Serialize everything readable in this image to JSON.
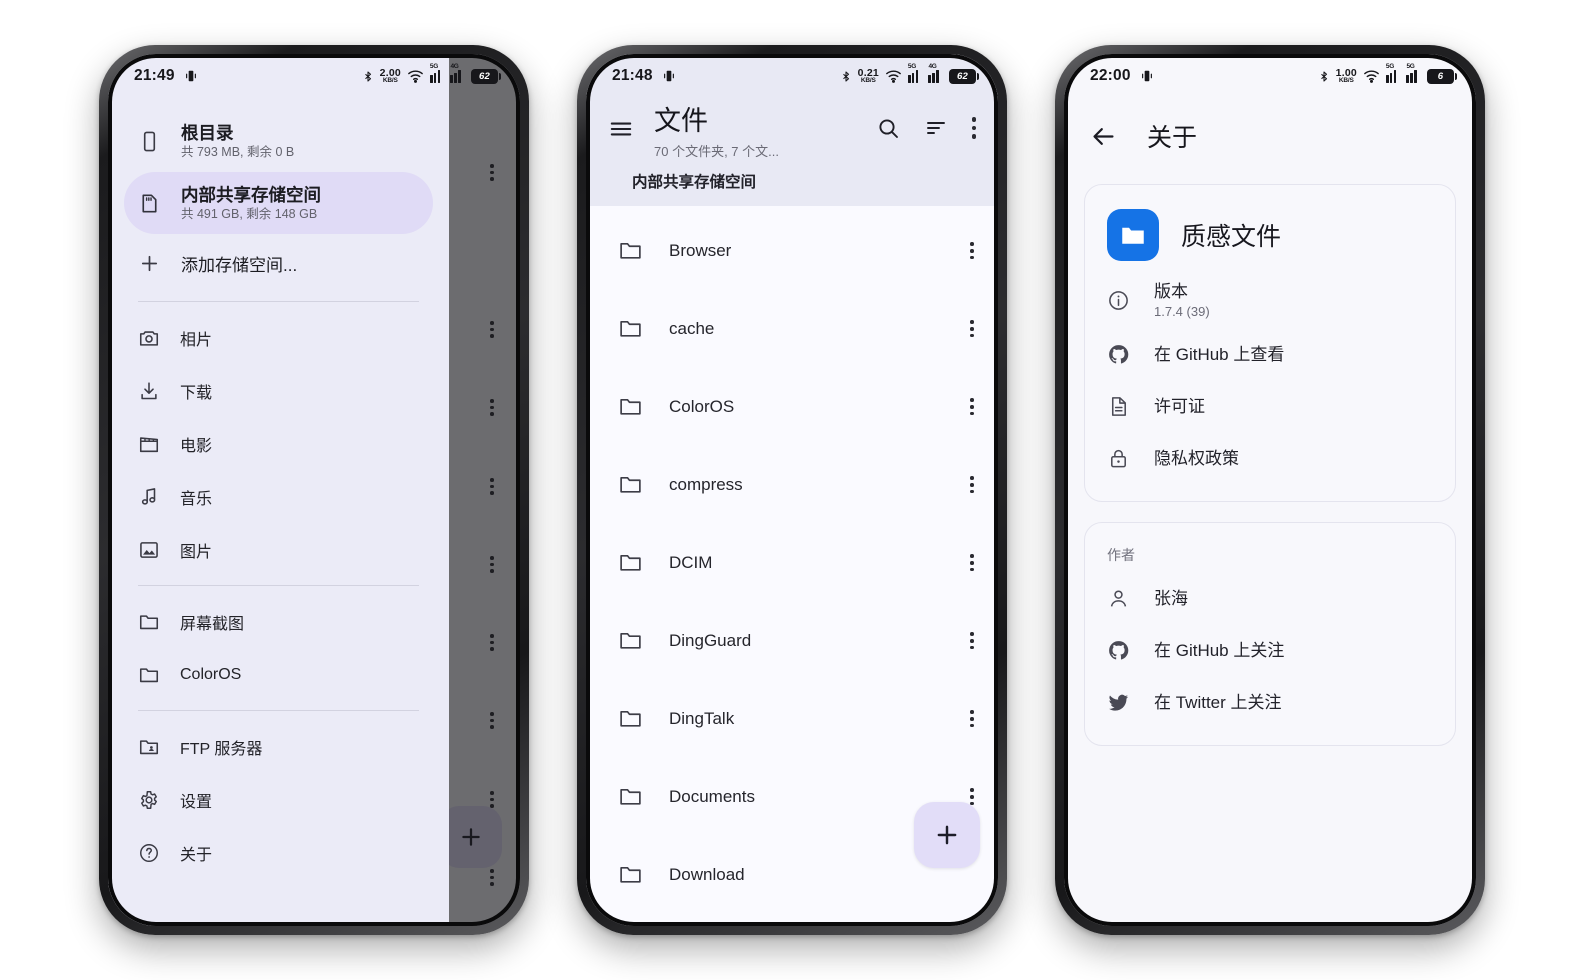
{
  "phone1": {
    "status_bar": {
      "time": "21:49",
      "net_speed_value": "2.00",
      "net_speed_unit": "KB/S",
      "signal1_label": "5G",
      "signal2_label": "4G",
      "battery": "62"
    },
    "drawer": {
      "storages": [
        {
          "icon": "phone-storage-icon",
          "title": "根目录",
          "subtitle": "共 793 MB, 剩余 0 B",
          "selected": false
        },
        {
          "icon": "sd-card-icon",
          "title": "内部共享存储空间",
          "subtitle": "共 491 GB, 剩余 148 GB",
          "selected": true
        }
      ],
      "add_storage_label": "添加存储空间...",
      "media_items": [
        {
          "icon": "camera-icon",
          "label": "相片"
        },
        {
          "icon": "download-icon",
          "label": "下载"
        },
        {
          "icon": "movie-icon",
          "label": "电影"
        },
        {
          "icon": "music-note-icon",
          "label": "音乐"
        },
        {
          "icon": "image-icon",
          "label": "图片"
        }
      ],
      "folder_items": [
        {
          "icon": "folder-icon",
          "label": "屏幕截图"
        },
        {
          "icon": "folder-icon",
          "label": "ColorOS"
        }
      ],
      "tool_items": [
        {
          "icon": "ftp-folder-icon",
          "label": "FTP 服务器"
        },
        {
          "icon": "gear-icon",
          "label": "设置"
        },
        {
          "icon": "help-circle-icon",
          "label": "关于"
        }
      ]
    },
    "background": {
      "fab_icon": "plus-icon"
    }
  },
  "phone2": {
    "status_bar": {
      "time": "21:48",
      "net_speed_value": "0.21",
      "net_speed_unit": "KB/S",
      "signal1_label": "5G",
      "signal2_label": "4G",
      "battery": "62"
    },
    "header": {
      "menu_icon": "hamburger-menu-icon",
      "title": "文件",
      "subtitle": "70 个文件夹, 7 个文...",
      "search_icon": "search-icon",
      "sort_icon": "sort-icon",
      "overflow_icon": "more-vertical-icon",
      "path": "内部共享存储空间"
    },
    "files": [
      {
        "icon": "folder-icon",
        "name": "Browser"
      },
      {
        "icon": "folder-icon",
        "name": "cache"
      },
      {
        "icon": "folder-icon",
        "name": "ColorOS"
      },
      {
        "icon": "folder-icon",
        "name": "compress"
      },
      {
        "icon": "folder-icon",
        "name": "DCIM"
      },
      {
        "icon": "folder-icon",
        "name": "DingGuard"
      },
      {
        "icon": "folder-icon",
        "name": "DingTalk"
      },
      {
        "icon": "folder-icon",
        "name": "Documents"
      },
      {
        "icon": "folder-icon",
        "name": "Download"
      }
    ],
    "fab": {
      "icon": "plus-icon"
    }
  },
  "phone3": {
    "status_bar": {
      "time": "22:00",
      "net_speed_value": "1.00",
      "net_speed_unit": "KB/S",
      "signal1_label": "5G",
      "signal2_label": "5G",
      "battery": "6"
    },
    "header": {
      "back_icon": "arrow-left-icon",
      "title": "关于"
    },
    "app_card": {
      "app_icon": "folder-app-icon",
      "app_name": "质感文件",
      "rows": [
        {
          "icon": "info-circle-icon",
          "label": "版本",
          "sub": "1.7.4 (39)"
        },
        {
          "icon": "github-icon",
          "label": "在 GitHub 上查看",
          "sub": ""
        },
        {
          "icon": "document-icon",
          "label": "许可证",
          "sub": ""
        },
        {
          "icon": "lock-icon",
          "label": "隐私权政策",
          "sub": ""
        }
      ]
    },
    "author_card": {
      "header": "作者",
      "rows": [
        {
          "icon": "person-icon",
          "label": "张海"
        },
        {
          "icon": "github-icon",
          "label": "在 GitHub 上关注"
        },
        {
          "icon": "twitter-icon",
          "label": "在 Twitter 上关注"
        }
      ]
    }
  },
  "colors": {
    "accent_lavender": "#e2ddf8",
    "selected_row": "#e0dbf6",
    "drawer_bg": "#ebebf7",
    "header_bg": "#e8e9f4",
    "app_icon_blue": "#1573e6",
    "scrim": "rgba(22,22,26,0.62)"
  }
}
